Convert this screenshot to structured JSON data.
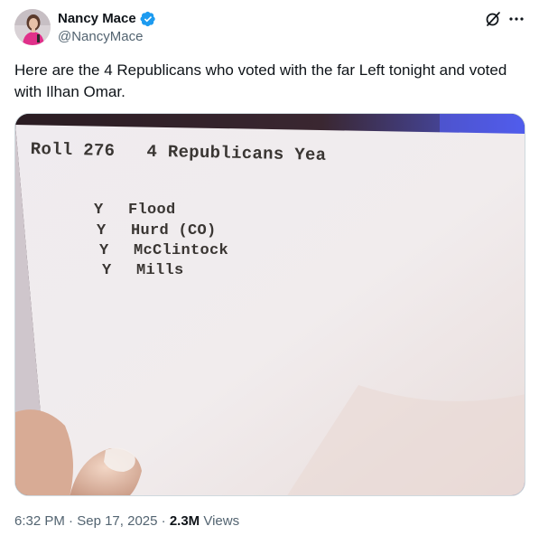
{
  "author": {
    "display_name": "Nancy Mace",
    "handle": "@NancyMace",
    "verified_color": "#1d9bf0"
  },
  "tweet": {
    "text": "Here are the 4 Republicans who voted with the far Left tonight and voted with Ilhan Omar."
  },
  "photo": {
    "roll_title": "Roll 276   4 Republicans Yea",
    "rows": [
      {
        "vote": "Y",
        "name": "Flood"
      },
      {
        "vote": "Y",
        "name": "Hurd (CO)"
      },
      {
        "vote": "Y",
        "name": "McClintock"
      },
      {
        "vote": "Y",
        "name": "Mills"
      }
    ]
  },
  "meta": {
    "time": "6:32 PM",
    "sep1": " · ",
    "date": "Sep 17, 2025",
    "sep2": " · ",
    "views_count": "2.3M",
    "views_label": " Views"
  },
  "icons": {
    "top_right": [
      "grok-icon",
      "more-icon"
    ]
  },
  "colors": {
    "text_primary": "#0f1419",
    "text_secondary": "#536471",
    "verified_blue": "#1d9bf0"
  }
}
